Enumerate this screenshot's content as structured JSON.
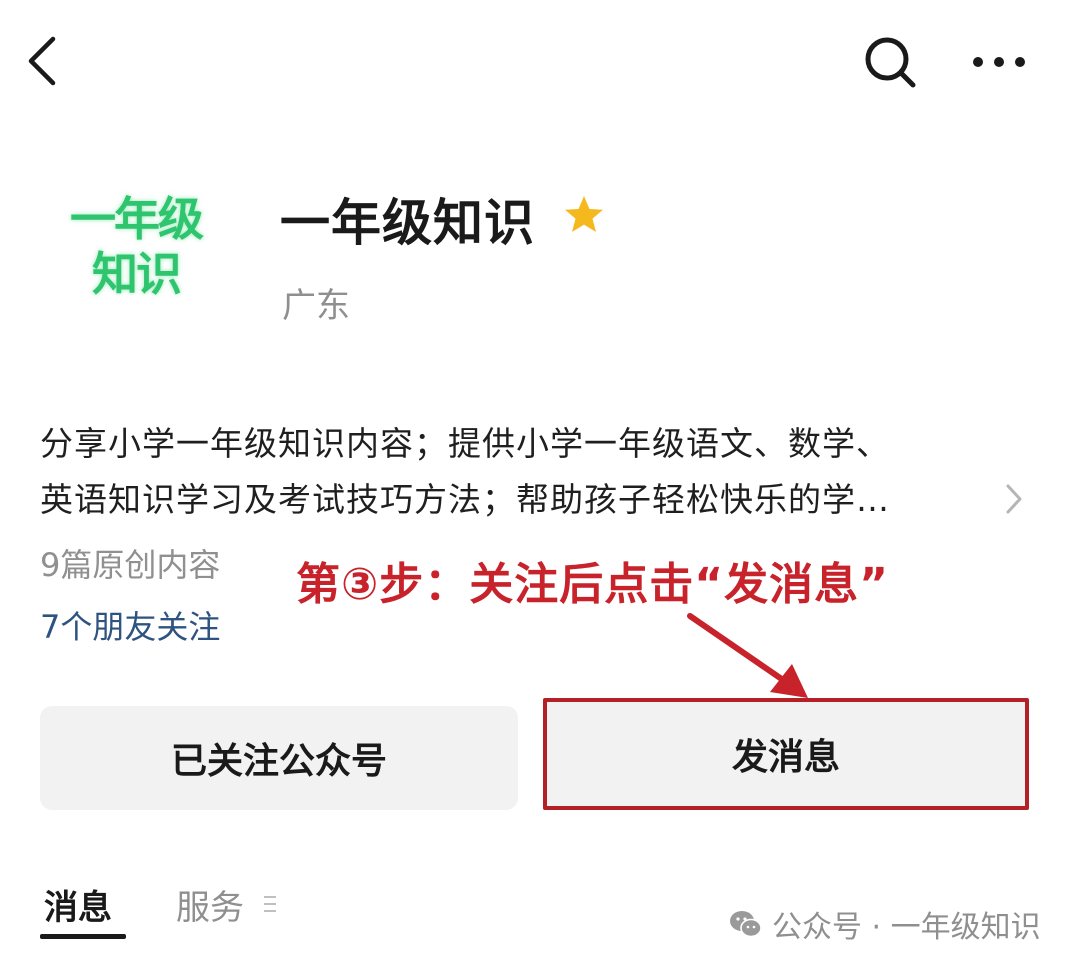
{
  "header": {
    "back_icon": "chevron-left-icon",
    "search_icon": "search-icon",
    "more_icon": "more-horizontal-icon"
  },
  "profile": {
    "avatar_line1": "一年级",
    "avatar_line2": "知识",
    "name": "一年级知识",
    "star_icon": "star-icon",
    "star_color": "#f5b91e",
    "location": "广东",
    "description_line1": "分享小学一年级知识内容；提供小学一年级语文、数学、",
    "description_line2": "英语知识学习及考试技巧方法；帮助孩子轻松快乐的学…",
    "original_count": "9篇原创内容",
    "friends_following": "7个朋友关注"
  },
  "annotation": {
    "text": "第③步：关注后点击“发消息”",
    "color": "#c8222b"
  },
  "actions": {
    "following_label": "已关注公众号",
    "message_label": "发消息"
  },
  "tabs": {
    "messages": "消息",
    "services": "服务"
  },
  "watermark": {
    "text": "公众号 · 一年级知识"
  }
}
